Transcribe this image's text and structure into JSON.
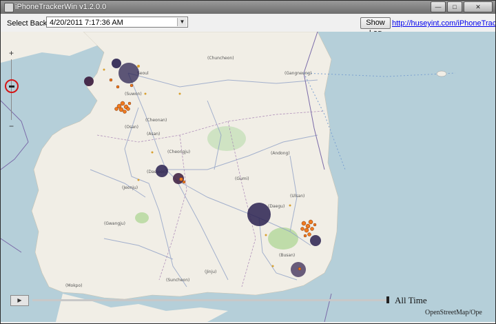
{
  "window": {
    "title": "iPhoneTrackerWin v1.2.0.0",
    "minimize_icon": "minimize-icon",
    "maximize_icon": "maximize-icon",
    "close_icon": "close-icon"
  },
  "toolbar": {
    "backup_label": "Select Backup:",
    "backup_value": "4/20/2011 7:17:36 AM",
    "show_log_label": "Show Log",
    "link_text": "http://huseyint.com/iPhoneTracerkWin"
  },
  "map": {
    "zoom_in": "+",
    "zoom_out": "−",
    "city_labels": {
      "seoul": "Seoul",
      "suwon": "(Suwon)",
      "osan": "(Osan)",
      "cheonan": "(Cheonan)",
      "asan": "(Asan)",
      "cheongju": "(Cheongju)",
      "daejeon": "(Daejeon)",
      "gumi": "(Gumi)",
      "daegu": "(Daegu)",
      "andong": "(Andong)",
      "jeonju": "(Jeonju)",
      "gwangju": "(Gwangju)",
      "suncheon": "(Suncheon)",
      "jinju": "(Jinju)",
      "ulsan": "(Ulsan)",
      "busan": "(Busan)",
      "gangneung": "(Gangneung)",
      "chuncheon": "(Chuncheon)",
      "mokpo": "(Mokpo)"
    },
    "play_icon": "play-icon",
    "timeline_label": "All Time",
    "attribution": "OpenStreetMap/Ope",
    "colors": {
      "water": "#b5cfd9",
      "land": "#f1eee6",
      "marker_dark": "#2a2150",
      "marker_orange": "#f07a1e"
    }
  }
}
